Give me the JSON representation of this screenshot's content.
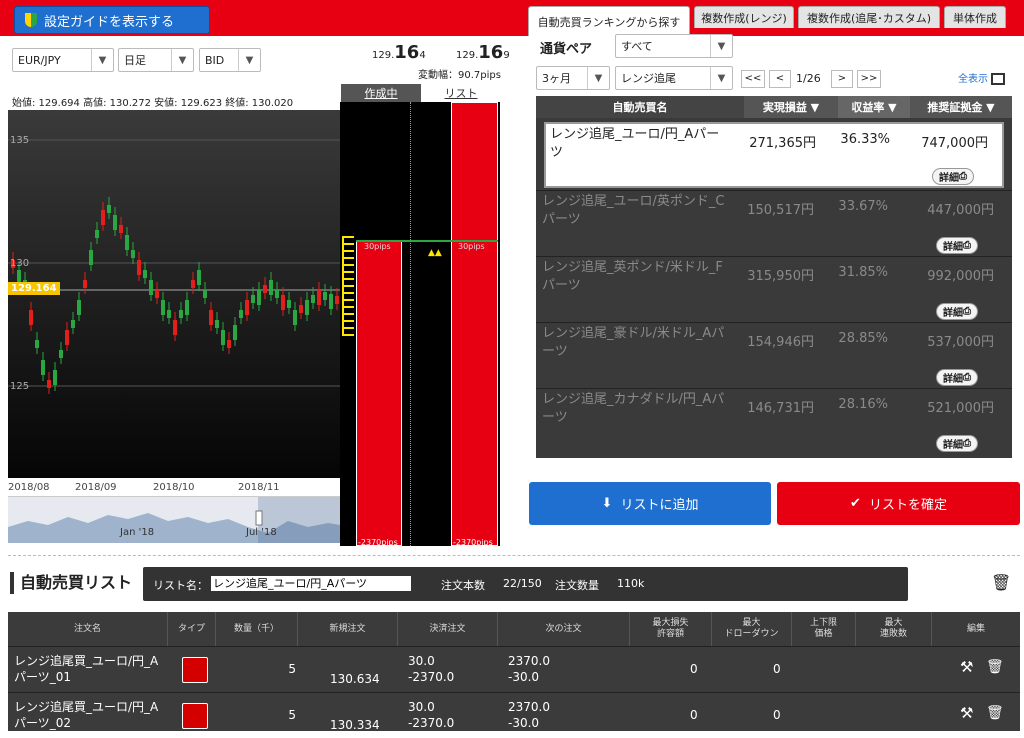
{
  "header": {
    "guide_button": "設定ガイドを表示する",
    "tabs": [
      {
        "label": "自動売買ランキングから探す"
      },
      {
        "label": "複数作成(レンジ)"
      },
      {
        "label": "複数作成(追尾･カスタム)"
      },
      {
        "label": "単体作成"
      }
    ]
  },
  "left": {
    "pair": "EUR/JPY",
    "timeframe": "日足",
    "side": "BID",
    "bid_main": "129.",
    "bid_big": "16",
    "bid_small": "4",
    "ask_main": "129.",
    "ask_big": "16",
    "ask_small": "9",
    "range_text": "変動幅：90.7pips",
    "ohlc": "始値: 129.694  高値: 130.272  安値: 129.623  終値: 130.020",
    "y_labels": [
      "135",
      "130",
      "125"
    ],
    "current_price": "129.164",
    "x_labels": [
      "2018/08",
      "2018/09",
      "2018/10",
      "2018/11"
    ],
    "nav_labels": [
      "Jan '18",
      "Jul '18"
    ],
    "panel_tabs": [
      "作成中",
      "リスト"
    ],
    "tag_30pips": "30pips",
    "tag_2370pips": "-2370pips"
  },
  "right": {
    "pair_label": "通貨ペア",
    "pair_value": "すべて",
    "period": "3ヶ月",
    "strategy": "レンジ追尾",
    "pager": {
      "first": "<<",
      "prev": "<",
      "page": "1/26",
      "next": ">",
      "last": ">>"
    },
    "show_all": "全表示",
    "columns": [
      "自動売買名",
      "実現損益 ▼",
      "収益率 ▼",
      "推奨証拠金 ▼"
    ],
    "rows": [
      {
        "name": "レンジ追尾_ユーロ/円_Aパーツ",
        "profit": "271,365円",
        "rate": "36.33%",
        "margin": "747,000円"
      },
      {
        "name": "レンジ追尾_ユーロ/英ポンド_Cパーツ",
        "profit": "150,517円",
        "rate": "33.67%",
        "margin": "447,000円"
      },
      {
        "name": "レンジ追尾_英ポンド/米ドル_Fパーツ",
        "profit": "315,950円",
        "rate": "31.85%",
        "margin": "992,000円"
      },
      {
        "name": "レンジ追尾_豪ドル/米ドル_Aパーツ",
        "profit": "154,946円",
        "rate": "28.85%",
        "margin": "537,000円"
      },
      {
        "name": "レンジ追尾_カナダドル/円_Aパーツ",
        "profit": "146,731円",
        "rate": "28.16%",
        "margin": "521,000円"
      }
    ],
    "detail_label": "詳細",
    "add_button": "リストに追加",
    "confirm_button": "リストを確定"
  },
  "list": {
    "title": "自動売買リスト",
    "name_label": "リスト名：",
    "name_value": "レンジ追尾_ユーロ/円_Aパーツ",
    "count_label": "注文本数",
    "count_value": "22/150",
    "qty_label": "注文数量",
    "qty_value": "110k",
    "headers": [
      "注文名",
      "タイプ",
      "数量（千）",
      "新規注文",
      "決済注文",
      "次の注文",
      "最大損失\n許容額",
      "最大\nドローダウン",
      "上下限\n価格",
      "最大\n連敗数",
      "編集"
    ],
    "rows": [
      {
        "name": "レンジ追尾買_ユーロ/円_Aパーツ_01",
        "qty": "5",
        "new": "130.634",
        "settle1": "30.0",
        "settle2": "-2370.0",
        "next1": "2370.0",
        "next2": "-30.0",
        "loss": "0",
        "dd": "0"
      },
      {
        "name": "レンジ追尾買_ユーロ/円_Aパーツ_02",
        "qty": "5",
        "new": "130.334",
        "settle1": "30.0",
        "settle2": "-2370.0",
        "next1": "2370.0",
        "next2": "-30.0",
        "loss": "0",
        "dd": "0"
      }
    ]
  },
  "colors": {
    "brand_red": "#e60012",
    "button_blue": "#1f6fd1",
    "candle_up": "#2aa642",
    "candle_down": "#e0201b",
    "highlight_yellow": "#ffe600"
  }
}
